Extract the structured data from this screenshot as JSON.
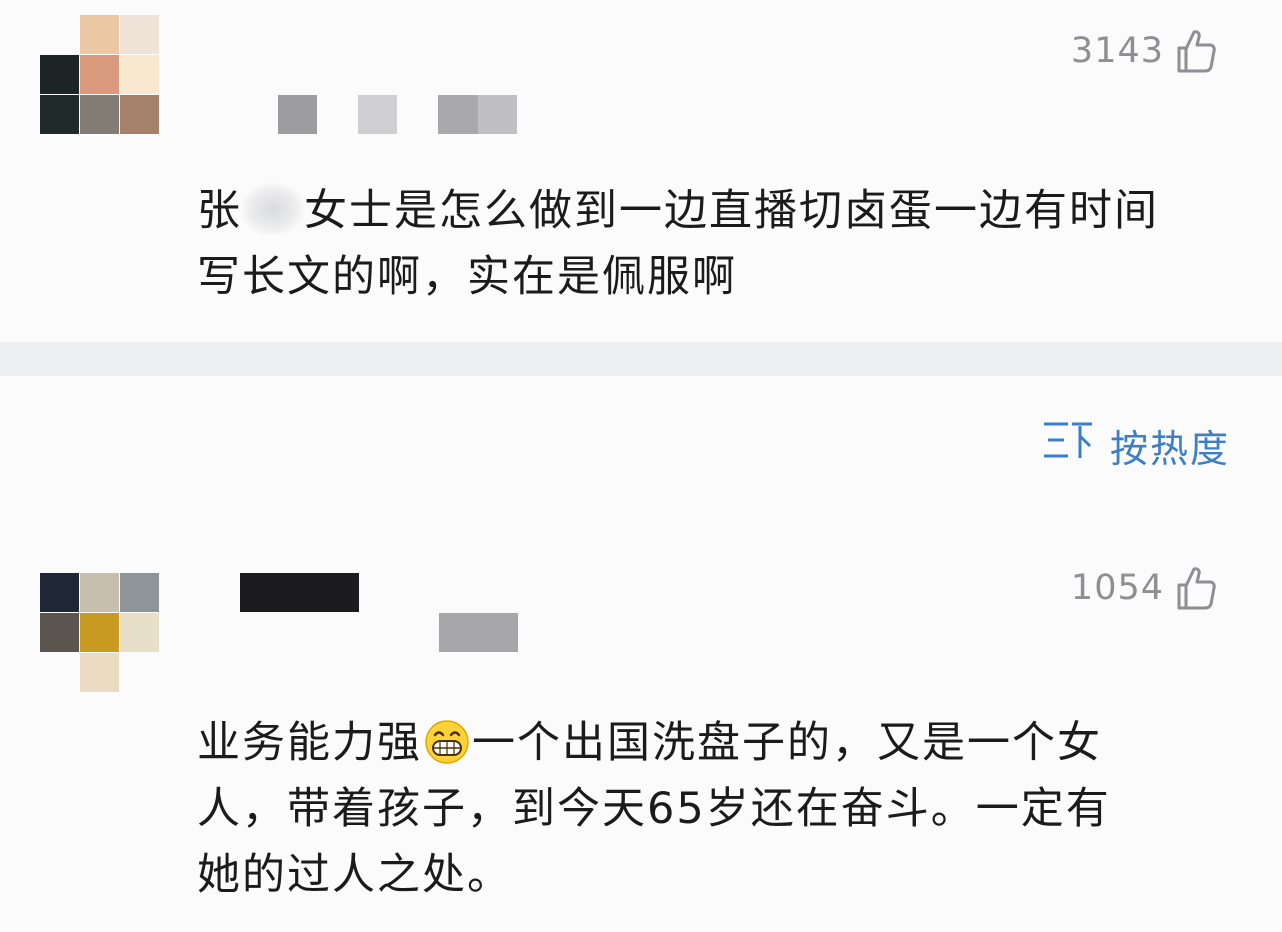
{
  "comments": [
    {
      "likes": "3143",
      "text_line1_a": "张",
      "text_line1_b": "女士是怎么做到一边直播切卤蛋一边有时间",
      "text_line2": "写长文的啊，实在是佩服啊"
    },
    {
      "likes": "1054",
      "text_line1_a": "业务能力强",
      "text_line1_b": "一个出国洗盘子的，又是一个女",
      "text_line2": "人，带着孩子，到今天65岁还在奋斗。一定有",
      "text_line3": "她的过人之处。"
    }
  ],
  "sort": {
    "icon": "sort-icon",
    "label": "按热度"
  },
  "icons": {
    "like": "thumbs-up-icon",
    "emoji": "grinning-face-icon"
  },
  "colors": {
    "accent": "#3d7fc6",
    "meta_gray": "#8e8e93",
    "background": "#fbfbfc",
    "divider": "#eeeff1"
  }
}
